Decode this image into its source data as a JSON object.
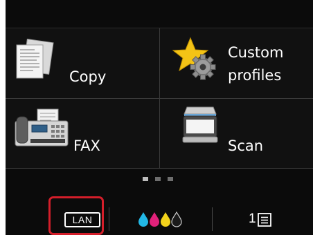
{
  "tiles": {
    "copy": {
      "label": "Copy",
      "icon": "copy-documents-icon"
    },
    "custom_profiles": {
      "label_line1": "Custom",
      "label_line2": "profiles",
      "icon": "star-gear-icon"
    },
    "fax": {
      "label": "FAX",
      "icon": "fax-machine-icon"
    },
    "scan": {
      "label": "Scan",
      "icon": "scanner-icon"
    }
  },
  "pagination": {
    "pages": 3,
    "current": 1
  },
  "status_bar": {
    "lan": {
      "label": "LAN",
      "highlight_color": "#d41e2a"
    },
    "ink": {
      "icon": "ink-levels-icon",
      "colors": [
        "#22b8e6",
        "#e0217a",
        "#f2d21b",
        "#bdbdbd"
      ]
    },
    "paper": {
      "number": "1",
      "icon": "paper-tray-icon"
    }
  }
}
